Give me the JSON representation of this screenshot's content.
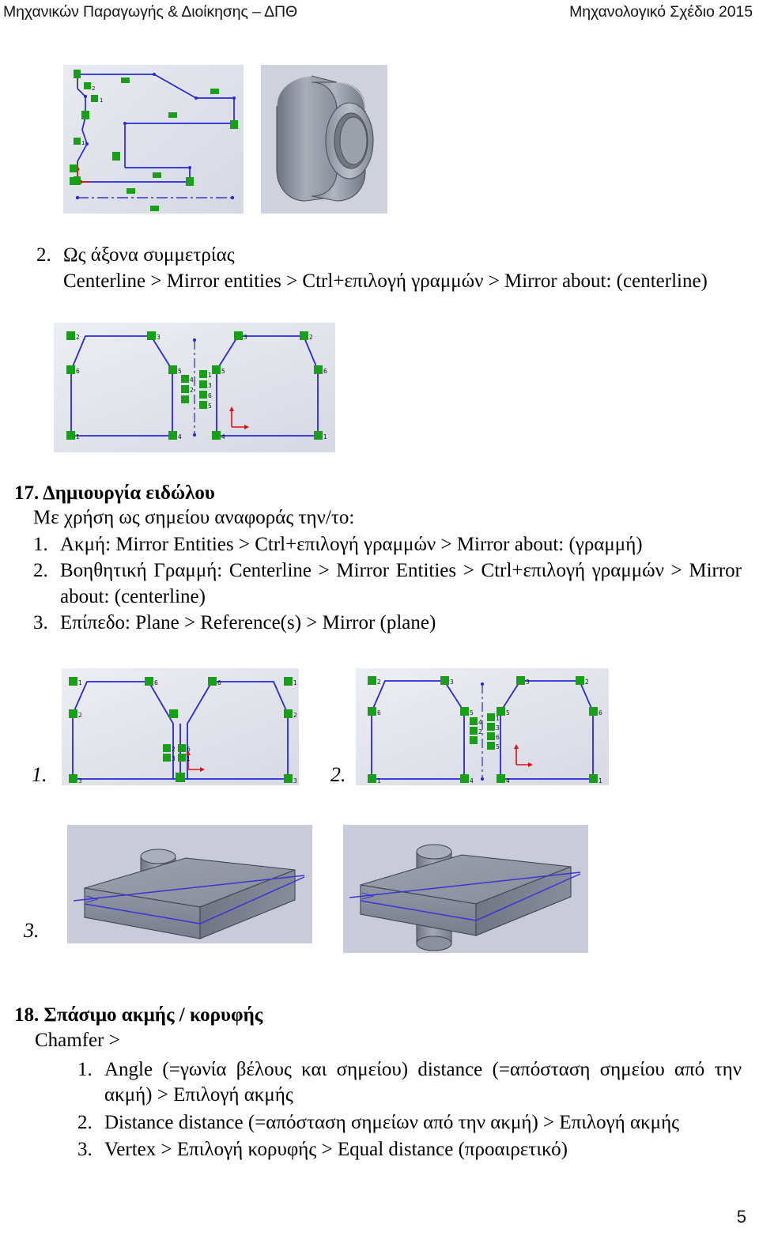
{
  "header": {
    "left": "Μηχανικών Παραγωγής & Διοίκησης – ΔΠΘ",
    "right": "Μηχανολογικό Σχέδιο  2015"
  },
  "page_number": "5",
  "section_16_item2": {
    "number": "2.",
    "title": "Ως άξονα συμμετρίας",
    "steps": "Centerline > Mirror entities > Ctrl+επιλογή γραμμών > Mirror about: (centerline)"
  },
  "section_17": {
    "number": "17.",
    "title": "Δημιουργία ειδώλου",
    "lead": "Με χρήση ως σημείου αναφοράς την/το:",
    "items": [
      {
        "num": "1.",
        "text": "Ακμή: Mirror Entities > Ctrl+επιλογή γραμμών > Mirror about: (γραμμή)"
      },
      {
        "num": "2.",
        "text": "Βοηθητική Γραμμή: Centerline > Mirror Entities > Ctrl+επιλογή γραμμών >  Mirror about: (centerline)"
      },
      {
        "num": "3.",
        "text": "Επίπεδο: Plane > Reference(s) > Mirror (plane)"
      }
    ],
    "figure_labels": [
      "1.",
      "2.",
      "3."
    ]
  },
  "section_18": {
    "number": "18.",
    "title": "Σπάσιμο ακμής / κορυφής",
    "lead": "Chamfer >",
    "items": [
      {
        "num": "1.",
        "text": "Angle (=γωνία βέλους και σημείου) distance (=απόσταση σημείου από την ακμή) > Επιλογή ακμής"
      },
      {
        "num": "2.",
        "text": "Distance distance (=απόσταση σημείων  από την ακμή)  > Επιλογή ακμής"
      },
      {
        "num": "3.",
        "text": "Vertex > Επιλογή κορυφής > Equal distance (προαιρετικό)"
      }
    ]
  },
  "figures": {
    "revolve_sketch": {
      "caption": "CAD profile sketch with centerline and equal-length constraints"
    },
    "revolve_model": {
      "caption": "Stepped cylindrical bushing 3D model"
    },
    "mirror_centerline_sketch": {
      "caption": "Two trapezoid profiles mirrored about a vertical centerline"
    },
    "mirror_edge_sketch": {
      "caption": "Two trapezoid profiles mirrored about a shared edge"
    },
    "mirror_centerline_sketch_2": {
      "caption": "Two trapezoid profiles mirrored about a vertical centerline"
    },
    "plane_model_before": {
      "caption": "Block with boss cylinder on top and mirror plane"
    },
    "plane_model_after": {
      "caption": "Block with boss cylinder mirrored to top and bottom"
    }
  },
  "colors": {
    "sketch_line": "#2828d8",
    "constraint_green": "#17a017",
    "origin_red": "#e01010",
    "model_gray": "#8a8e99",
    "figure_bg": "#d9dbe4",
    "plane_blue": "#3a34d6"
  }
}
